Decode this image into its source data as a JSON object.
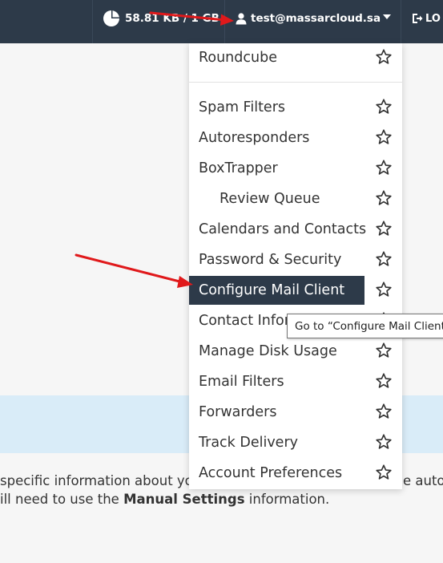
{
  "topbar": {
    "disk_usage": "58.81 KB / 1 GB",
    "user_email": "test@massarcloud.sa",
    "logout_label": "LO"
  },
  "menu": {
    "items": [
      {
        "label": "Roundcube"
      },
      {
        "label": "Spam Filters"
      },
      {
        "label": "Autoresponders"
      },
      {
        "label": "BoxTrapper"
      },
      {
        "label": "Review Queue"
      },
      {
        "label": "Calendars and Contacts"
      },
      {
        "label": "Password & Security"
      },
      {
        "label": "Configure Mail Client"
      },
      {
        "label": "Contact Inform"
      },
      {
        "label": "Manage Disk Usage"
      },
      {
        "label": "Email Filters"
      },
      {
        "label": "Forwarders"
      },
      {
        "label": "Track Delivery"
      },
      {
        "label": "Account Preferences"
      }
    ]
  },
  "tooltip": {
    "text": "Go to “Configure Mail Client"
  },
  "content": {
    "line1_left": "specific information about yo",
    "line1_right": "e auto",
    "line2_pre": "ill need to use the ",
    "line2_bold": "Manual Settings",
    "line2_post": " information."
  },
  "colors": {
    "header_bg": "#2d3a49",
    "highlight_bg": "#2d3a49",
    "arrow": "#e0191b",
    "info_band": "#d9ecf8"
  }
}
